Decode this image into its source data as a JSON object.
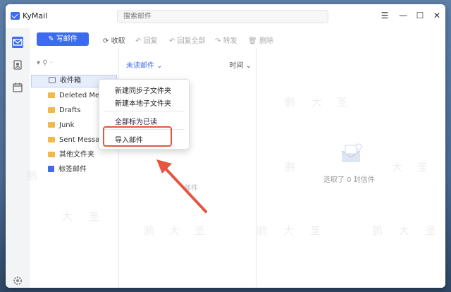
{
  "app": {
    "title": "KyMail",
    "accent": "#3d6bf0"
  },
  "titlebar": {
    "search_placeholder": "搜索邮件",
    "menu_icon": "☰",
    "minimize_icon": "—",
    "maximize_icon": "☐",
    "close_icon": "✕"
  },
  "toolbar": {
    "compose": "写邮件",
    "receive": "收取",
    "reply": "回复",
    "reply_all": "回复全部",
    "forward": "转发",
    "delete": "删除"
  },
  "sidebar": {
    "account": "▾ ⚲ ·",
    "folders": [
      {
        "label": "收件箱"
      },
      {
        "label": "Deleted Messa"
      },
      {
        "label": "Drafts"
      },
      {
        "label": "Junk"
      },
      {
        "label": "Sent Message"
      },
      {
        "label": "其他文件夹"
      },
      {
        "label": "标签邮件"
      }
    ]
  },
  "maillist": {
    "filter": "未读邮件 ⌄",
    "sort": "时间 ⌄",
    "ghost_text": "邮件"
  },
  "preview": {
    "empty_text": "选取了 0 封信件"
  },
  "context_menu": {
    "items": [
      "新建同步子文件夹",
      "新建本地子文件夹",
      "全部标为已读",
      "导入邮件"
    ]
  },
  "annotation": {
    "highlight_color": "#e5553f"
  },
  "watermarks": [
    "鹏",
    "大",
    "圣"
  ]
}
